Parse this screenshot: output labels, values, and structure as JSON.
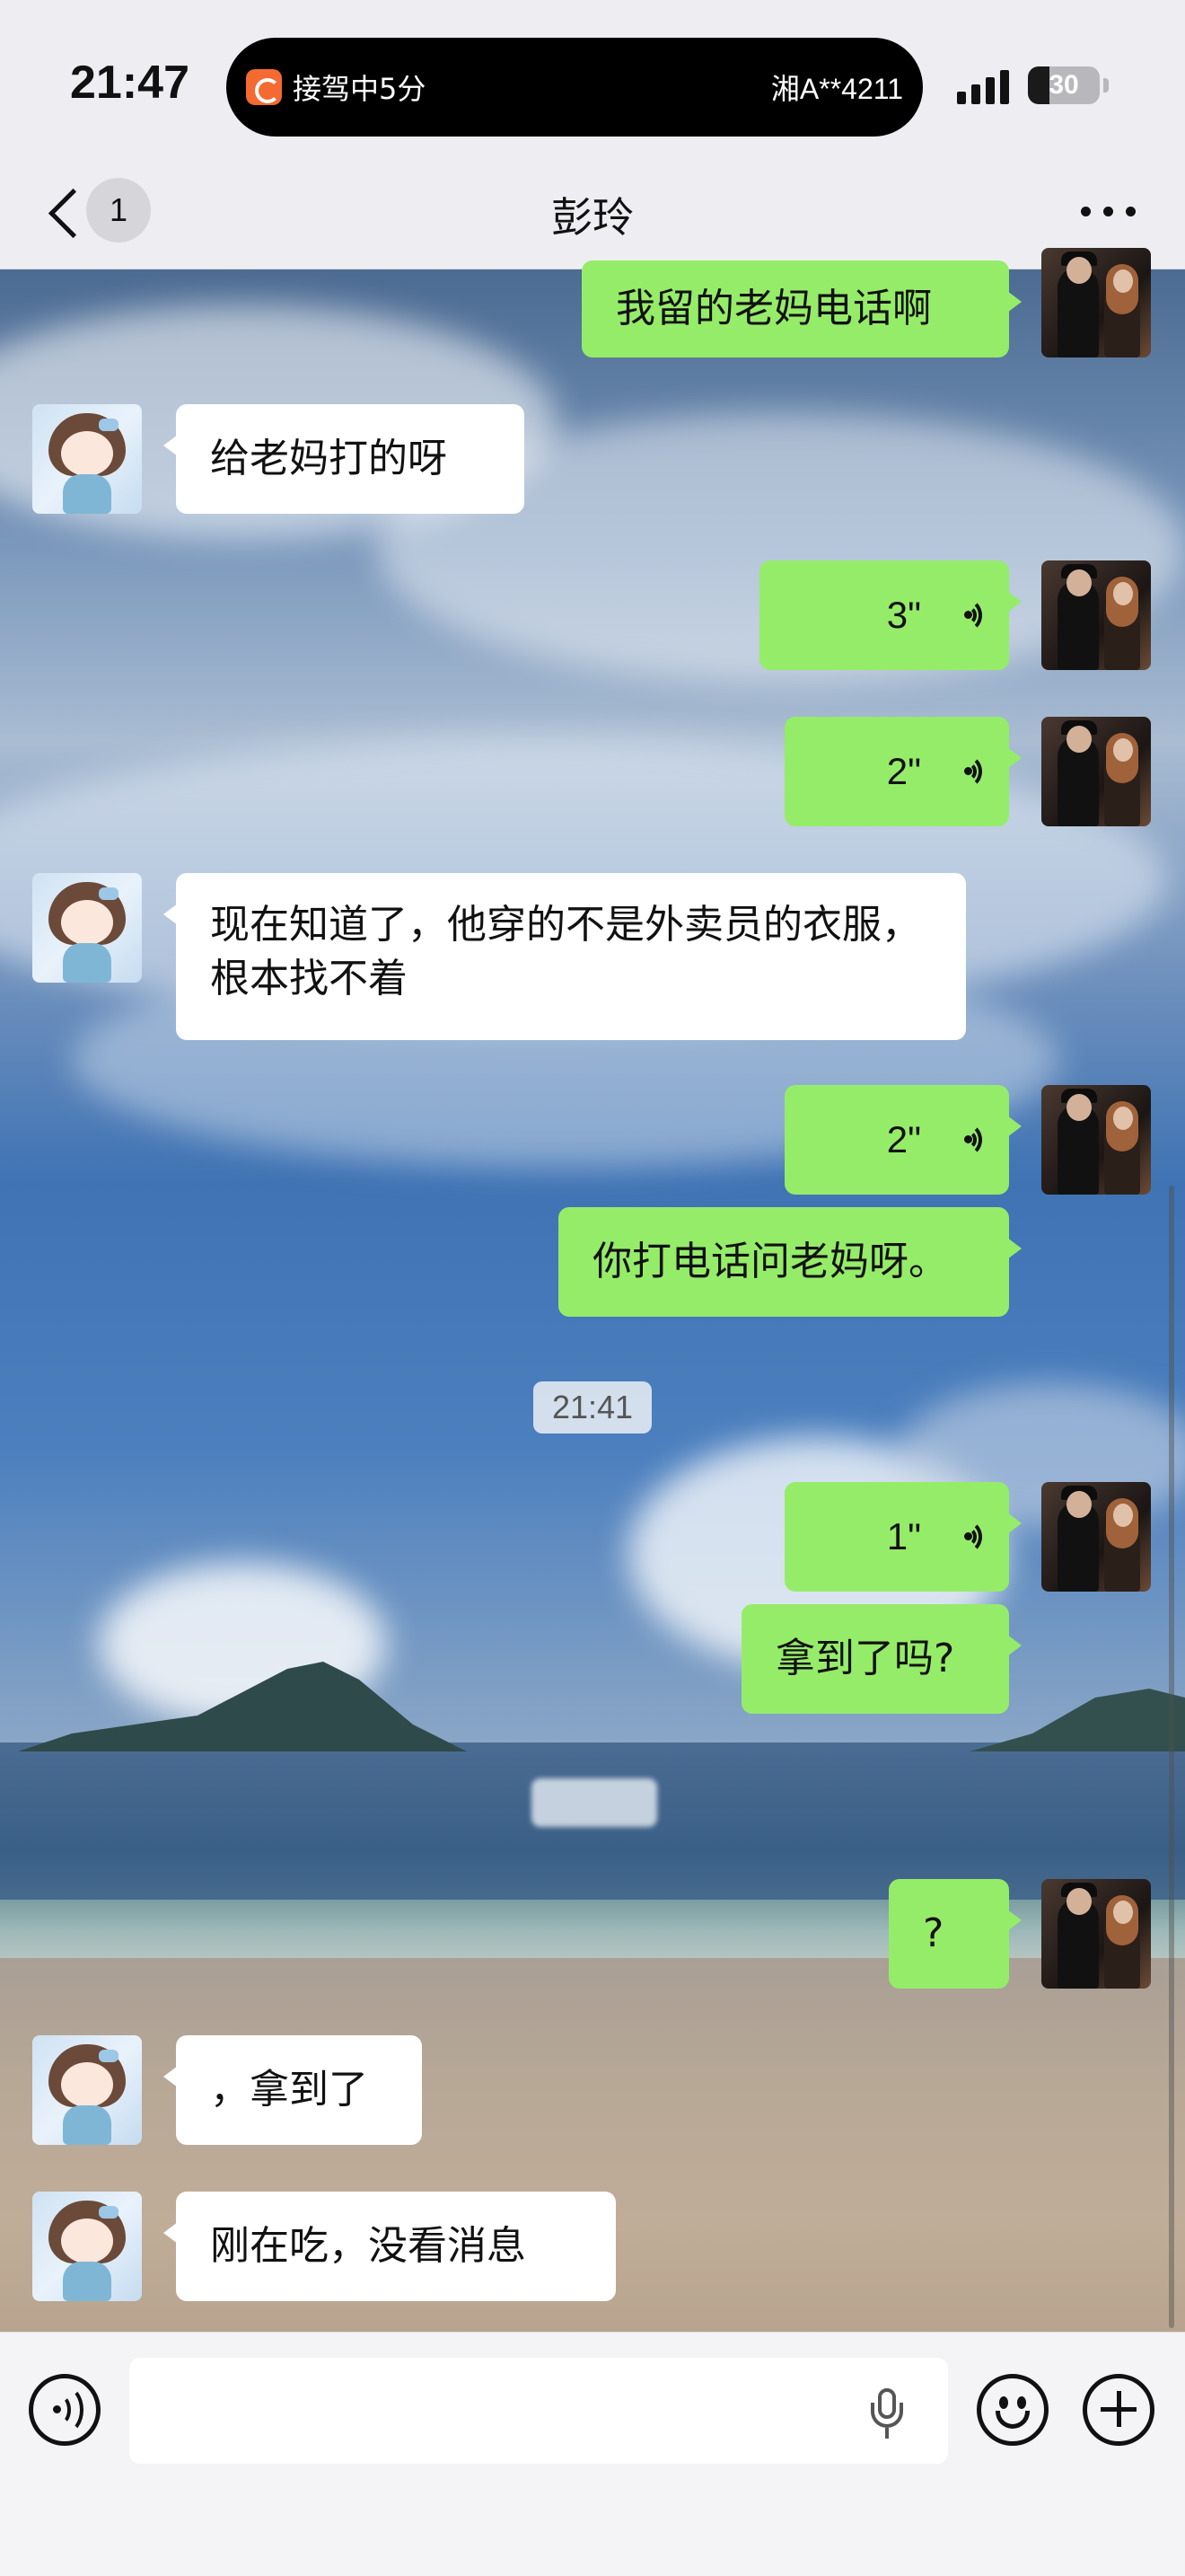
{
  "status_bar": {
    "time": "21:47",
    "live_activity_left": "接驾中5分",
    "live_activity_right": "湘A**4211",
    "battery": "30",
    "battery_level_percent": 30,
    "live_activity_icon": "didi-app-icon"
  },
  "nav": {
    "back_icon": "chevron-left-icon",
    "unread_count": "1",
    "title": "彭玲",
    "more_icon": "more-dots-icon"
  },
  "messages": [
    {
      "sender": "me",
      "type": "text",
      "text": "我留的老妈电话啊"
    },
    {
      "sender": "her",
      "type": "text",
      "text": "给老妈打的呀"
    },
    {
      "sender": "me",
      "type": "voice",
      "duration": "3\""
    },
    {
      "sender": "me",
      "type": "voice",
      "duration": "2\""
    },
    {
      "sender": "her",
      "type": "text",
      "text": "现在知道了，他穿的不是外卖员的衣服，根本找不着"
    },
    {
      "sender": "me",
      "type": "voice",
      "duration": "2\""
    },
    {
      "sender": "me",
      "type": "text",
      "text": "你打电话问老妈呀。"
    },
    {
      "type": "timestamp",
      "text": "21:41"
    },
    {
      "sender": "me",
      "type": "voice",
      "duration": "1\""
    },
    {
      "sender": "me",
      "type": "text",
      "text": "拿到了吗?"
    },
    {
      "sender": "me",
      "type": "text",
      "text": "?"
    },
    {
      "sender": "her",
      "type": "text",
      "text": "，拿到了"
    },
    {
      "sender": "her",
      "type": "text",
      "text": "刚在吃，没看消息"
    }
  ],
  "input_bar": {
    "voice_toggle_icon": "voice-mode-icon",
    "input_value": "",
    "mic_icon": "microphone-icon",
    "emoji_icon": "emoji-smile-icon",
    "plus_icon": "plus-circle-icon"
  },
  "colors": {
    "my_bubble": "#95ec69",
    "her_bubble": "#ffffff",
    "bar_background": "#eeeef2"
  }
}
